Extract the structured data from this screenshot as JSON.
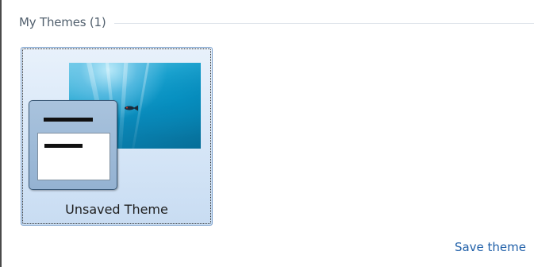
{
  "my_themes": {
    "header": "My Themes (1)",
    "themes": [
      {
        "name": "Unsaved Theme",
        "selected": true,
        "preview_icon": "desktop-window-preview-icon",
        "wallpaper": "underwater-blue-fish"
      }
    ],
    "save_link": "Save theme"
  },
  "colors": {
    "header_text": "#52606e",
    "link": "#1f5fa8",
    "tile_border": "#7da2ce",
    "tile_fill": "#d6e6f7"
  }
}
